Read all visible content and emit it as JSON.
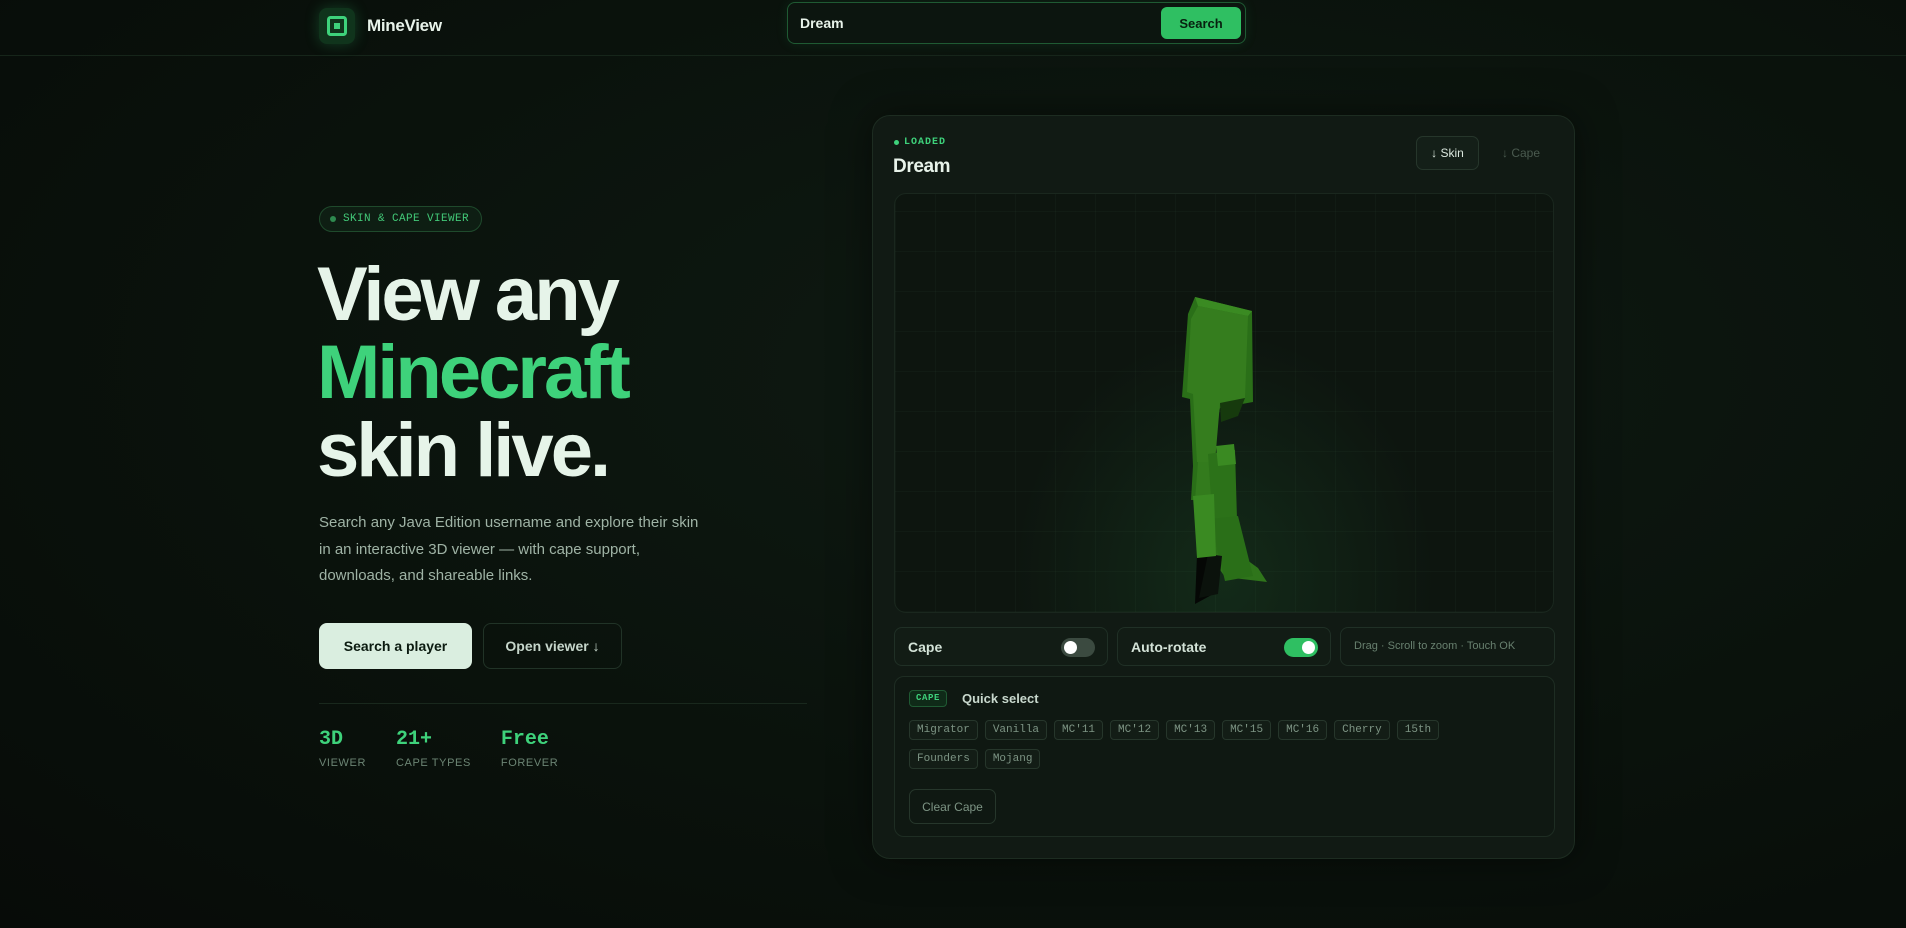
{
  "header": {
    "brand_name": "MineView",
    "logo_icon": "cube-logo-icon",
    "search_value": "Dream",
    "search_button": "Search"
  },
  "hero": {
    "badge": "SKIN & CAPE VIEWER",
    "title_line1": "View any",
    "title_line2": "Minecraft",
    "title_line3": "skin live.",
    "description": "Search any Java Edition username and explore their skin in an interactive 3D viewer — with cape support, downloads, and shareable links.",
    "primary_button": "Search a player",
    "secondary_button": "Open viewer ↓",
    "stats": [
      {
        "value": "3D",
        "label": "VIEWER"
      },
      {
        "value": "21+",
        "label": "CAPE TYPES"
      },
      {
        "value": "Free",
        "label": "FOREVER"
      }
    ]
  },
  "viewer_panel": {
    "status": "LOADED",
    "player_name": "Dream",
    "download_skin": "↓ Skin",
    "download_cape": "↓ Cape",
    "controls": {
      "cape_label": "Cape",
      "cape_enabled": false,
      "autorotate_label": "Auto-rotate",
      "autorotate_enabled": true,
      "hint": "Drag · Scroll to zoom · Touch OK"
    },
    "cape_select": {
      "tag": "CAPE",
      "title": "Quick select",
      "options": [
        "Migrator",
        "Vanilla",
        "MC'11",
        "MC'12",
        "MC'13",
        "MC'15",
        "MC'16",
        "Cherry",
        "15th",
        "Founders",
        "Mojang"
      ],
      "clear_button": "Clear Cape"
    }
  },
  "colors": {
    "accent": "#3ed27b",
    "button_green": "#2fbf62",
    "background": "#0a120c",
    "skin_green": "#3a8a22"
  }
}
